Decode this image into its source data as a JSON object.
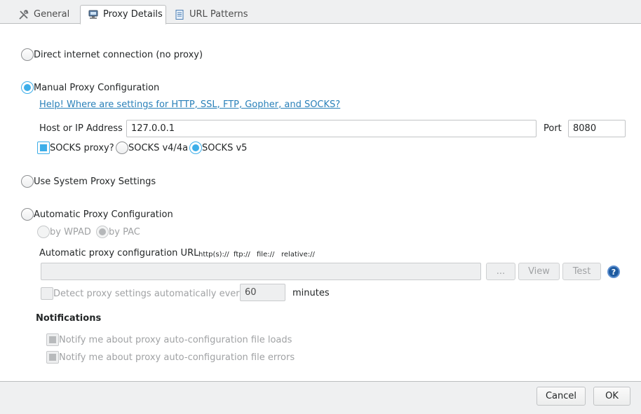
{
  "tabs": [
    {
      "label": "General",
      "icon": "tools-icon",
      "active": false
    },
    {
      "label": "Proxy Details",
      "icon": "network-icon",
      "active": true
    },
    {
      "label": "URL Patterns",
      "icon": "document-icon",
      "active": false
    }
  ],
  "options": {
    "direct": "Direct internet connection (no proxy)",
    "manual": "Manual Proxy Configuration",
    "system": "Use System Proxy Settings",
    "automatic": "Automatic Proxy Configuration"
  },
  "manual": {
    "help_link": "Help! Where are settings for HTTP, SSL, FTP, Gopher, and SOCKS?",
    "host_label": "Host or IP Address",
    "host_value": "127.0.0.1",
    "port_label": "Port",
    "port_value": "8080",
    "socks_label": "SOCKS proxy?",
    "socks_v4_label": "SOCKS v4/4a",
    "socks_v5_label": "SOCKS v5"
  },
  "automatic": {
    "by_wpad": "by WPAD",
    "by_pac": "by PAC",
    "url_label": "Automatic proxy configuration URL",
    "protocols": [
      "http(s)://",
      "ftp://",
      "file://",
      "relative://"
    ],
    "url_value": "",
    "browse_label": "...",
    "view_label": "View",
    "test_label": "Test",
    "detect_label": "Detect proxy settings automatically every",
    "detect_minutes": "60",
    "minutes_label": "minutes"
  },
  "notifications": {
    "heading": "Notifications",
    "notify_loads": "Notify me about proxy auto-configuration file loads",
    "notify_errors": "Notify me about proxy auto-configuration file errors"
  },
  "footer": {
    "cancel": "Cancel",
    "ok": "OK"
  },
  "colors": {
    "accent": "#3daee9",
    "link": "#2980b9"
  }
}
